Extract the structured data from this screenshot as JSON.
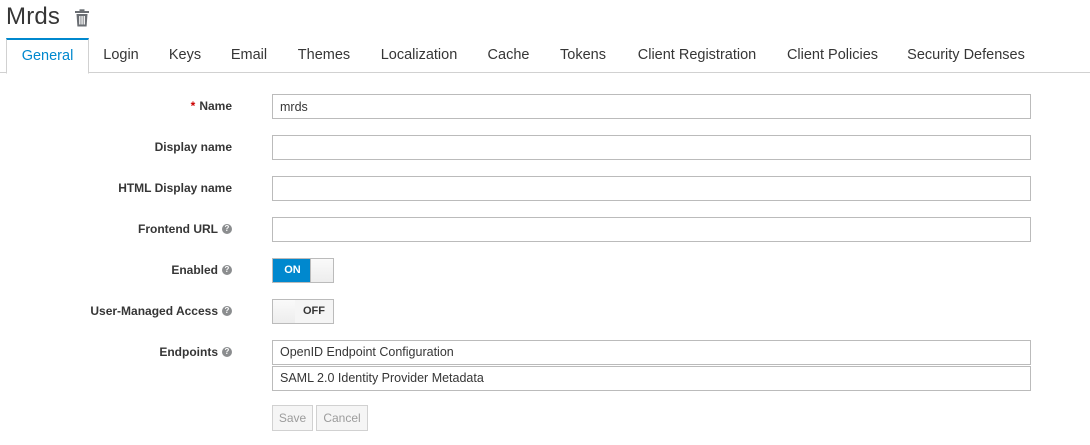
{
  "header": {
    "realm_title": "Mrds",
    "delete_icon": "trash-icon"
  },
  "tabs": [
    {
      "label": "General",
      "active": true
    },
    {
      "label": "Login"
    },
    {
      "label": "Keys"
    },
    {
      "label": "Email"
    },
    {
      "label": "Themes"
    },
    {
      "label": "Localization"
    },
    {
      "label": "Cache"
    },
    {
      "label": "Tokens"
    },
    {
      "label": "Client Registration"
    },
    {
      "label": "Client Policies"
    },
    {
      "label": "Security Defenses"
    }
  ],
  "form": {
    "name": {
      "label": "Name",
      "required_marker": "*",
      "value": "mrds"
    },
    "display_name": {
      "label": "Display name",
      "value": ""
    },
    "html_display_name": {
      "label": "HTML Display name",
      "value": ""
    },
    "frontend_url": {
      "label": "Frontend URL",
      "value": ""
    },
    "enabled": {
      "label": "Enabled",
      "state": "ON"
    },
    "user_managed_access": {
      "label": "User-Managed Access",
      "state": "OFF"
    },
    "endpoints": {
      "label": "Endpoints",
      "items": [
        "OpenID Endpoint Configuration",
        "SAML 2.0 Identity Provider Metadata"
      ]
    },
    "help_icon": "question-circle-icon"
  },
  "actions": {
    "save_label": "Save",
    "cancel_label": "Cancel"
  },
  "colors": {
    "accent": "#0088ce",
    "required": "#cc0000"
  }
}
